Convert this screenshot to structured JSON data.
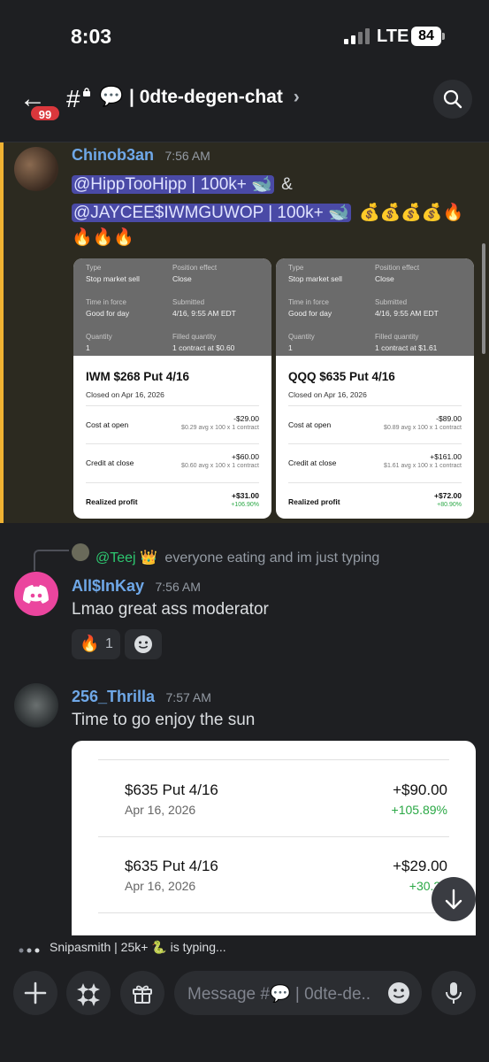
{
  "status": {
    "time": "8:03",
    "network": "LTE",
    "battery": "84"
  },
  "header": {
    "unread_badge": "99",
    "channel_icon": "💬",
    "channel_name": "| 0dte-degen-chat",
    "chevron": "›"
  },
  "messages": [
    {
      "username": "Chinob3an",
      "username_color": "#6fa8e8",
      "time": "7:56 AM",
      "mention1": "@HippTooHipp | 100k+ 🐋",
      "amp": "&",
      "mention2": "@JAYCEE$IWMGUWOP | 100k+ 🐋",
      "emojis_line1": "💰💰💰💰🔥",
      "emojis_line2": "🔥🔥🔥",
      "attachments": [
        {
          "type_label": "Type",
          "type_value": "Stop market sell",
          "effect_label": "Position effect",
          "effect_value": "Close",
          "tif_label": "Time in force",
          "tif_value": "Good for day",
          "submitted_label": "Submitted",
          "submitted_value": "4/16, 9:55 AM EDT",
          "qty_label": "Quantity",
          "qty_value": "1",
          "filled_label": "Filled quantity",
          "filled_value": "1 contract at $0.60",
          "title": "IWM $268 Put 4/16",
          "closed": "Closed on Apr 16, 2026",
          "cost_label": "Cost at open",
          "cost_value": "-$29.00",
          "cost_detail": "$0.29 avg x 100 x 1 contract",
          "credit_label": "Credit at close",
          "credit_value": "+$60.00",
          "credit_detail": "$0.60 avg x 100 x 1 contract",
          "profit_label": "Realized profit",
          "profit_value": "+$31.00",
          "profit_pct": "+106.90%"
        },
        {
          "type_label": "Type",
          "type_value": "Stop market sell",
          "effect_label": "Position effect",
          "effect_value": "Close",
          "tif_label": "Time in force",
          "tif_value": "Good for day",
          "submitted_label": "Submitted",
          "submitted_value": "4/16, 9:55 AM EDT",
          "qty_label": "Quantity",
          "qty_value": "1",
          "filled_label": "Filled quantity",
          "filled_value": "1 contract at $1.61",
          "title": "QQQ $635 Put 4/16",
          "closed": "Closed on Apr 16, 2026",
          "cost_label": "Cost at open",
          "cost_value": "-$89.00",
          "cost_detail": "$0.89 avg x 100 x 1 contract",
          "credit_label": "Credit at close",
          "credit_value": "+$161.00",
          "credit_detail": "$1.61 avg x 100 x 1 contract",
          "profit_label": "Realized profit",
          "profit_value": "+$72.00",
          "profit_pct": "+80.90%"
        }
      ]
    },
    {
      "reply_to_user": "@Teej 👑",
      "reply_text": "everyone eating and im just typing",
      "username": "All$InKay",
      "username_color": "#6fa8e8",
      "time": "7:56 AM",
      "text": "Lmao great ass moderator",
      "reaction_emoji": "🔥",
      "reaction_count": "1"
    },
    {
      "username": "256_Thrilla",
      "username_color": "#6fa8e8",
      "time": "7:57 AM",
      "text": "Time to go enjoy the sun",
      "image_rows": [
        {
          "title": "$635 Put 4/16",
          "date": "Apr 16, 2026",
          "amount": "+$90.00",
          "pct": "+105.89%"
        },
        {
          "title": "$635 Put 4/16",
          "date": "Apr 16, 2026",
          "amount": "+$29.00",
          "pct": "+30.21"
        }
      ]
    }
  ],
  "typing": {
    "text": "Snipasmith | 25k+ 🐍 is typing..."
  },
  "composer": {
    "placeholder": "Message #💬 | 0dte-de.."
  },
  "colors": {
    "accent": "#5865f2",
    "highlight_bar": "#f0b232",
    "badge": "#da373c",
    "profit_green": "#2aa845"
  }
}
